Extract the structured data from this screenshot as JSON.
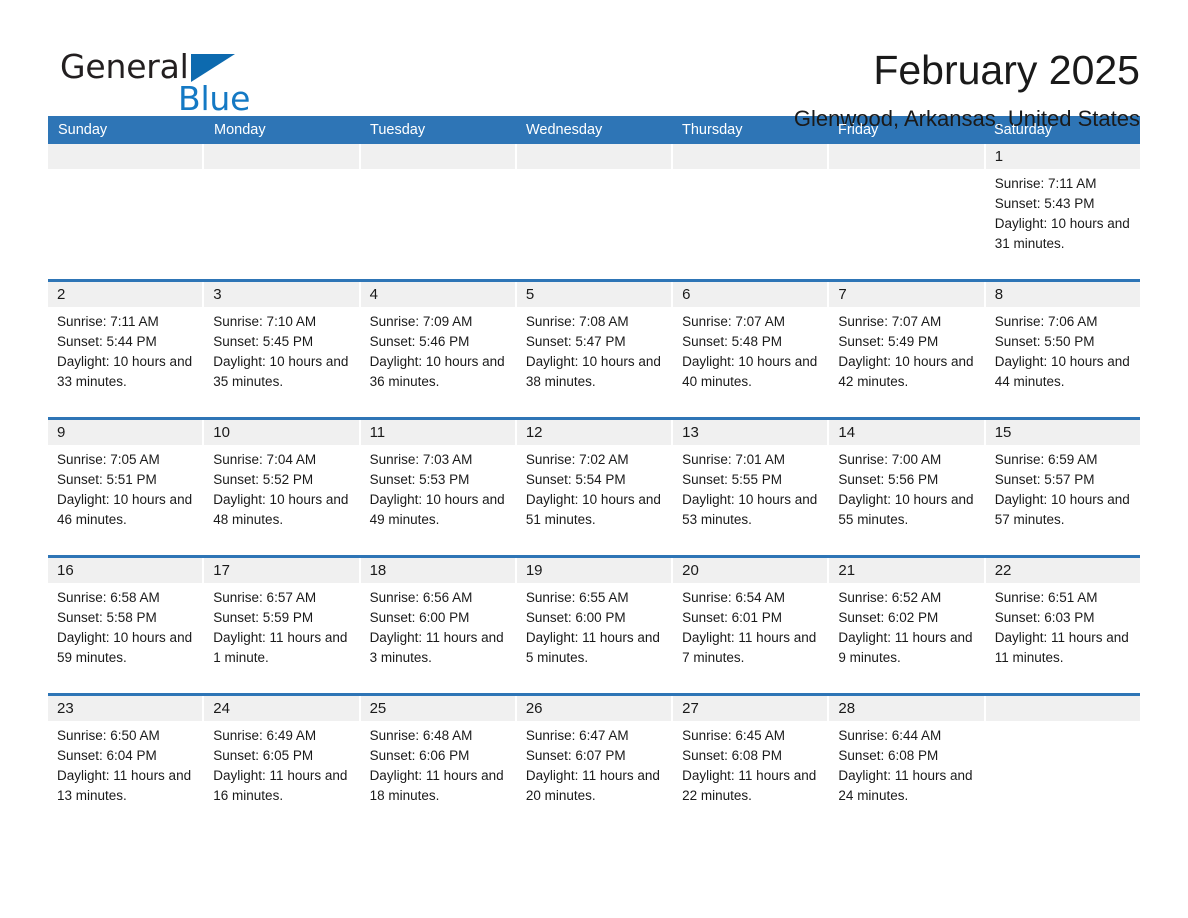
{
  "logo": {
    "word_one": "General",
    "word_two": "Blue",
    "triangle_color": "#0d6aaf",
    "blue_text_color": "#1479c4"
  },
  "header": {
    "month_title": "February 2025",
    "location": "Glenwood, Arkansas, United States"
  },
  "theme": {
    "header_blue": "#2e75b6",
    "row_rule_blue": "#2e75b6",
    "daynum_band": "#f0f0f0",
    "text": "#1a1a1a"
  },
  "calendar": {
    "weekdays": [
      "Sunday",
      "Monday",
      "Tuesday",
      "Wednesday",
      "Thursday",
      "Friday",
      "Saturday"
    ],
    "weeks": [
      [
        {
          "day": "",
          "sunrise": "",
          "sunset": "",
          "daylight": ""
        },
        {
          "day": "",
          "sunrise": "",
          "sunset": "",
          "daylight": ""
        },
        {
          "day": "",
          "sunrise": "",
          "sunset": "",
          "daylight": ""
        },
        {
          "day": "",
          "sunrise": "",
          "sunset": "",
          "daylight": ""
        },
        {
          "day": "",
          "sunrise": "",
          "sunset": "",
          "daylight": ""
        },
        {
          "day": "",
          "sunrise": "",
          "sunset": "",
          "daylight": ""
        },
        {
          "day": "1",
          "sunrise": "Sunrise: 7:11 AM",
          "sunset": "Sunset: 5:43 PM",
          "daylight": "Daylight: 10 hours and 31 minutes."
        }
      ],
      [
        {
          "day": "2",
          "sunrise": "Sunrise: 7:11 AM",
          "sunset": "Sunset: 5:44 PM",
          "daylight": "Daylight: 10 hours and 33 minutes."
        },
        {
          "day": "3",
          "sunrise": "Sunrise: 7:10 AM",
          "sunset": "Sunset: 5:45 PM",
          "daylight": "Daylight: 10 hours and 35 minutes."
        },
        {
          "day": "4",
          "sunrise": "Sunrise: 7:09 AM",
          "sunset": "Sunset: 5:46 PM",
          "daylight": "Daylight: 10 hours and 36 minutes."
        },
        {
          "day": "5",
          "sunrise": "Sunrise: 7:08 AM",
          "sunset": "Sunset: 5:47 PM",
          "daylight": "Daylight: 10 hours and 38 minutes."
        },
        {
          "day": "6",
          "sunrise": "Sunrise: 7:07 AM",
          "sunset": "Sunset: 5:48 PM",
          "daylight": "Daylight: 10 hours and 40 minutes."
        },
        {
          "day": "7",
          "sunrise": "Sunrise: 7:07 AM",
          "sunset": "Sunset: 5:49 PM",
          "daylight": "Daylight: 10 hours and 42 minutes."
        },
        {
          "day": "8",
          "sunrise": "Sunrise: 7:06 AM",
          "sunset": "Sunset: 5:50 PM",
          "daylight": "Daylight: 10 hours and 44 minutes."
        }
      ],
      [
        {
          "day": "9",
          "sunrise": "Sunrise: 7:05 AM",
          "sunset": "Sunset: 5:51 PM",
          "daylight": "Daylight: 10 hours and 46 minutes."
        },
        {
          "day": "10",
          "sunrise": "Sunrise: 7:04 AM",
          "sunset": "Sunset: 5:52 PM",
          "daylight": "Daylight: 10 hours and 48 minutes."
        },
        {
          "day": "11",
          "sunrise": "Sunrise: 7:03 AM",
          "sunset": "Sunset: 5:53 PM",
          "daylight": "Daylight: 10 hours and 49 minutes."
        },
        {
          "day": "12",
          "sunrise": "Sunrise: 7:02 AM",
          "sunset": "Sunset: 5:54 PM",
          "daylight": "Daylight: 10 hours and 51 minutes."
        },
        {
          "day": "13",
          "sunrise": "Sunrise: 7:01 AM",
          "sunset": "Sunset: 5:55 PM",
          "daylight": "Daylight: 10 hours and 53 minutes."
        },
        {
          "day": "14",
          "sunrise": "Sunrise: 7:00 AM",
          "sunset": "Sunset: 5:56 PM",
          "daylight": "Daylight: 10 hours and 55 minutes."
        },
        {
          "day": "15",
          "sunrise": "Sunrise: 6:59 AM",
          "sunset": "Sunset: 5:57 PM",
          "daylight": "Daylight: 10 hours and 57 minutes."
        }
      ],
      [
        {
          "day": "16",
          "sunrise": "Sunrise: 6:58 AM",
          "sunset": "Sunset: 5:58 PM",
          "daylight": "Daylight: 10 hours and 59 minutes."
        },
        {
          "day": "17",
          "sunrise": "Sunrise: 6:57 AM",
          "sunset": "Sunset: 5:59 PM",
          "daylight": "Daylight: 11 hours and 1 minute."
        },
        {
          "day": "18",
          "sunrise": "Sunrise: 6:56 AM",
          "sunset": "Sunset: 6:00 PM",
          "daylight": "Daylight: 11 hours and 3 minutes."
        },
        {
          "day": "19",
          "sunrise": "Sunrise: 6:55 AM",
          "sunset": "Sunset: 6:00 PM",
          "daylight": "Daylight: 11 hours and 5 minutes."
        },
        {
          "day": "20",
          "sunrise": "Sunrise: 6:54 AM",
          "sunset": "Sunset: 6:01 PM",
          "daylight": "Daylight: 11 hours and 7 minutes."
        },
        {
          "day": "21",
          "sunrise": "Sunrise: 6:52 AM",
          "sunset": "Sunset: 6:02 PM",
          "daylight": "Daylight: 11 hours and 9 minutes."
        },
        {
          "day": "22",
          "sunrise": "Sunrise: 6:51 AM",
          "sunset": "Sunset: 6:03 PM",
          "daylight": "Daylight: 11 hours and 11 minutes."
        }
      ],
      [
        {
          "day": "23",
          "sunrise": "Sunrise: 6:50 AM",
          "sunset": "Sunset: 6:04 PM",
          "daylight": "Daylight: 11 hours and 13 minutes."
        },
        {
          "day": "24",
          "sunrise": "Sunrise: 6:49 AM",
          "sunset": "Sunset: 6:05 PM",
          "daylight": "Daylight: 11 hours and 16 minutes."
        },
        {
          "day": "25",
          "sunrise": "Sunrise: 6:48 AM",
          "sunset": "Sunset: 6:06 PM",
          "daylight": "Daylight: 11 hours and 18 minutes."
        },
        {
          "day": "26",
          "sunrise": "Sunrise: 6:47 AM",
          "sunset": "Sunset: 6:07 PM",
          "daylight": "Daylight: 11 hours and 20 minutes."
        },
        {
          "day": "27",
          "sunrise": "Sunrise: 6:45 AM",
          "sunset": "Sunset: 6:08 PM",
          "daylight": "Daylight: 11 hours and 22 minutes."
        },
        {
          "day": "28",
          "sunrise": "Sunrise: 6:44 AM",
          "sunset": "Sunset: 6:08 PM",
          "daylight": "Daylight: 11 hours and 24 minutes."
        },
        {
          "day": "",
          "sunrise": "",
          "sunset": "",
          "daylight": ""
        }
      ]
    ]
  }
}
